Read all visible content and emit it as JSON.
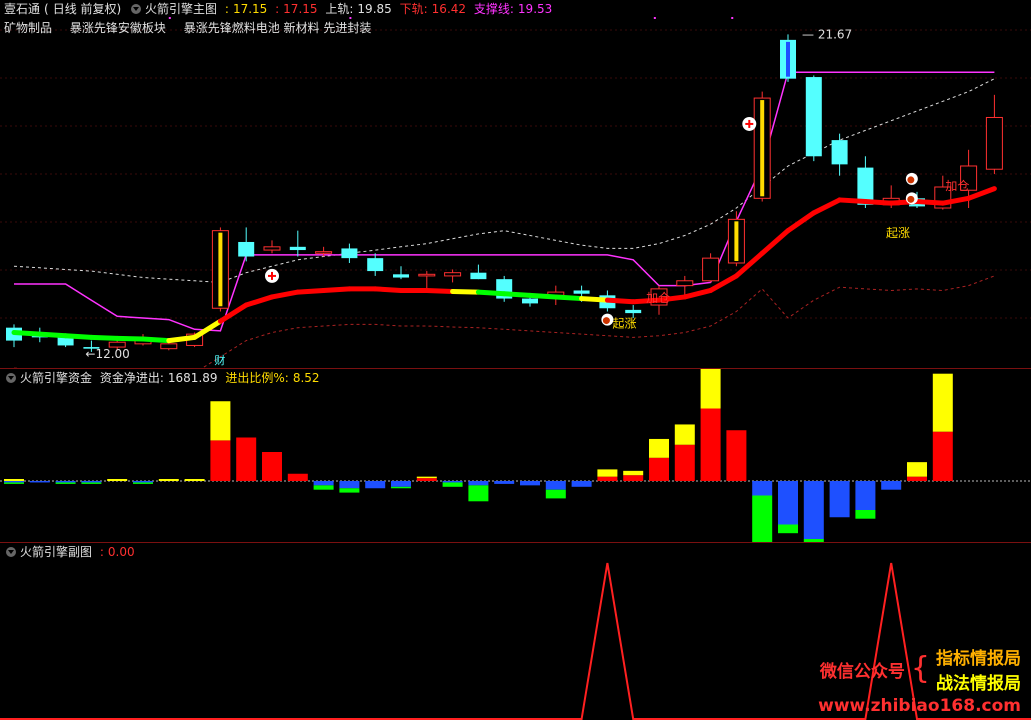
{
  "app": {
    "name": "壹石通",
    "mode": "日线 前复权"
  },
  "main": {
    "indicator_name": "火箭引擎主图",
    "values": [
      {
        "label": "",
        "value": "17.15",
        "color": "#ffdc00"
      },
      {
        "label": "",
        "value": "17.15",
        "color": "#ff3030"
      },
      {
        "label": "上轨",
        "value": "19.85",
        "color": "#e0e0e0"
      },
      {
        "label": "下轨",
        "value": "16.42",
        "color": "#ff3030"
      },
      {
        "label": "支撑线",
        "value": "19.53",
        "color": "#ff33ff"
      }
    ],
    "sectors": [
      "矿物制品",
      "暴涨先锋安徽板块",
      "暴涨先锋燃料电池 新材料 先进封装"
    ],
    "high_label": "21.67",
    "low_label": "12.00",
    "cai_label": "财",
    "signals": [
      {
        "text": "加仓",
        "color": "#ff3030"
      },
      {
        "text": "起涨",
        "color": "#ffdc00"
      },
      {
        "text": "加仓",
        "color": "#ff3030"
      },
      {
        "text": "起涨",
        "color": "#ffdc00"
      }
    ]
  },
  "fund": {
    "indicator_name": "火箭引擎资金",
    "net_label": "资金净进出",
    "net_value": "1681.89",
    "ratio_label": "进出比例%",
    "ratio_value": "8.52"
  },
  "sub": {
    "indicator_name": "火箭引擎副图",
    "value": "0.00"
  },
  "watermark": {
    "wechat": "微信公众号",
    "line1": "指标情报局",
    "line2": "战法情报局",
    "url": "www.zhibiao168.com"
  },
  "colors": {
    "up": "#ff3030",
    "down": "#54ffff",
    "support": "#ff33ff",
    "bull": "#ff0000",
    "bear": "#00ff00",
    "yellow": "#ffff00",
    "fund_out": "#1e50ff"
  },
  "chart_data": {
    "type": "candlestick",
    "candles": [
      {
        "o": 12.6,
        "h": 12.7,
        "l": 12.0,
        "c": 12.2
      },
      {
        "o": 12.4,
        "h": 12.6,
        "l": 12.15,
        "c": 12.3
      },
      {
        "o": 12.3,
        "h": 12.4,
        "l": 12.0,
        "c": 12.05
      },
      {
        "o": 12.0,
        "h": 12.2,
        "l": 11.85,
        "c": 11.95
      },
      {
        "o": 12.0,
        "h": 12.3,
        "l": 11.9,
        "c": 12.15
      },
      {
        "o": 12.1,
        "h": 12.4,
        "l": 12.05,
        "c": 12.2
      },
      {
        "o": 11.95,
        "h": 12.2,
        "l": 11.9,
        "c": 12.1
      },
      {
        "o": 12.05,
        "h": 12.45,
        "l": 12.0,
        "c": 12.4
      },
      {
        "o": 13.2,
        "h": 15.7,
        "l": 13.1,
        "c": 15.6
      },
      {
        "o": 15.25,
        "h": 15.7,
        "l": 14.65,
        "c": 14.8
      },
      {
        "o": 15.0,
        "h": 15.3,
        "l": 14.9,
        "c": 15.1
      },
      {
        "o": 15.1,
        "h": 15.6,
        "l": 14.8,
        "c": 15.0
      },
      {
        "o": 14.9,
        "h": 15.1,
        "l": 14.8,
        "c": 14.95
      },
      {
        "o": 15.05,
        "h": 15.2,
        "l": 14.6,
        "c": 14.75
      },
      {
        "o": 14.75,
        "h": 14.9,
        "l": 14.2,
        "c": 14.35
      },
      {
        "o": 14.25,
        "h": 14.5,
        "l": 14.1,
        "c": 14.15
      },
      {
        "o": 14.2,
        "h": 14.35,
        "l": 13.8,
        "c": 14.25
      },
      {
        "o": 14.2,
        "h": 14.4,
        "l": 14.0,
        "c": 14.3
      },
      {
        "o": 14.3,
        "h": 14.55,
        "l": 14.1,
        "c": 14.1
      },
      {
        "o": 14.1,
        "h": 14.2,
        "l": 13.4,
        "c": 13.5
      },
      {
        "o": 13.5,
        "h": 13.6,
        "l": 13.25,
        "c": 13.35
      },
      {
        "o": 13.6,
        "h": 13.9,
        "l": 13.3,
        "c": 13.7
      },
      {
        "o": 13.75,
        "h": 13.9,
        "l": 13.4,
        "c": 13.65
      },
      {
        "o": 13.6,
        "h": 13.75,
        "l": 13.1,
        "c": 13.2
      },
      {
        "o": 13.15,
        "h": 13.3,
        "l": 12.9,
        "c": 13.05
      },
      {
        "o": 13.3,
        "h": 13.9,
        "l": 13.0,
        "c": 13.8
      },
      {
        "o": 13.9,
        "h": 14.2,
        "l": 13.6,
        "c": 14.05
      },
      {
        "o": 14.05,
        "h": 14.9,
        "l": 14.0,
        "c": 14.75
      },
      {
        "o": 14.6,
        "h": 16.2,
        "l": 14.5,
        "c": 15.95
      },
      {
        "o": 16.6,
        "h": 19.9,
        "l": 16.5,
        "c": 19.7
      },
      {
        "o": 21.5,
        "h": 21.67,
        "l": 20.2,
        "c": 20.3
      },
      {
        "o": 20.35,
        "h": 20.4,
        "l": 17.75,
        "c": 17.9
      },
      {
        "o": 18.4,
        "h": 18.6,
        "l": 17.3,
        "c": 17.65
      },
      {
        "o": 17.55,
        "h": 17.9,
        "l": 16.3,
        "c": 16.4
      },
      {
        "o": 16.4,
        "h": 17.0,
        "l": 16.3,
        "c": 16.6
      },
      {
        "o": 16.6,
        "h": 16.8,
        "l": 16.3,
        "c": 16.35
      },
      {
        "o": 16.3,
        "h": 17.3,
        "l": 16.25,
        "c": 16.95
      },
      {
        "o": 16.85,
        "h": 18.1,
        "l": 16.3,
        "c": 17.6
      },
      {
        "o": 17.5,
        "h": 19.8,
        "l": 17.35,
        "c": 19.1
      }
    ],
    "ma_line": [
      12.45,
      12.4,
      12.35,
      12.3,
      12.27,
      12.25,
      12.2,
      12.3,
      12.8,
      13.3,
      13.55,
      13.7,
      13.75,
      13.8,
      13.8,
      13.75,
      13.75,
      13.72,
      13.7,
      13.65,
      13.6,
      13.55,
      13.5,
      13.45,
      13.4,
      13.45,
      13.55,
      13.75,
      14.2,
      14.9,
      15.6,
      16.15,
      16.55,
      16.5,
      16.45,
      16.5,
      16.45,
      16.6,
      16.9
    ],
    "upper_band": [
      14.5,
      14.45,
      14.4,
      14.35,
      14.25,
      14.15,
      14.1,
      14.05,
      14.0,
      14.3,
      14.5,
      14.7,
      14.8,
      14.9,
      15.0,
      15.1,
      15.2,
      15.35,
      15.5,
      15.6,
      15.45,
      15.3,
      15.15,
      15.05,
      15.05,
      15.2,
      15.45,
      15.8,
      16.3,
      16.95,
      17.6,
      18.0,
      18.4,
      18.7,
      19.0,
      19.3,
      19.6,
      19.9,
      20.3
    ],
    "support_line": [
      13.95,
      13.95,
      13.95,
      13.45,
      12.95,
      12.9,
      12.85,
      12.55,
      12.5,
      14.85,
      14.85,
      14.85,
      14.85,
      14.85,
      14.85,
      14.85,
      14.85,
      14.85,
      14.85,
      14.85,
      14.85,
      14.85,
      14.85,
      14.85,
      14.7,
      13.9,
      13.9,
      14.0,
      15.9,
      17.6,
      20.5,
      20.5,
      20.5,
      20.5,
      20.5,
      20.5,
      20.5,
      20.5,
      20.5
    ],
    "fund_flow": [
      {
        "b": -1,
        "y": -1,
        "g": -1
      },
      {
        "b": -1,
        "y": 0,
        "g": 0
      },
      {
        "b": -1,
        "y": 0,
        "g": -1
      },
      {
        "b": -1,
        "y": 0,
        "g": -1
      },
      {
        "b": 0,
        "y": 1,
        "g": 0
      },
      {
        "b": -1,
        "y": 0,
        "g": -1
      },
      {
        "b": 0,
        "y": 1,
        "g": 0
      },
      {
        "b": 0,
        "y": 1,
        "g": 0
      },
      {
        "r": 28,
        "y": 27
      },
      {
        "r": 30,
        "y": 0
      },
      {
        "r": 20,
        "y": 0
      },
      {
        "r": 5,
        "y": 0
      },
      {
        "b": -3,
        "g": -3
      },
      {
        "b": -5,
        "g": -3
      },
      {
        "b": -5,
        "g": 0
      },
      {
        "b": -4,
        "g": -1
      },
      {
        "r": 2,
        "y": 1
      },
      {
        "b": -1,
        "g": -3
      },
      {
        "b": -3,
        "g": -11
      },
      {
        "b": -2,
        "g": 0
      },
      {
        "b": -3,
        "g": 0
      },
      {
        "b": -6,
        "g": -6
      },
      {
        "b": -4,
        "g": 0
      },
      {
        "r": 3,
        "y": 5
      },
      {
        "r": 4,
        "y": 3
      },
      {
        "r": 16,
        "y": 13
      },
      {
        "r": 25,
        "y": 14
      },
      {
        "r": 50,
        "y": 40
      },
      {
        "r": 35,
        "y": 0
      },
      {
        "b": -10,
        "g": -50
      },
      {
        "b": -30,
        "g": -6
      },
      {
        "b": -40,
        "g": -14
      },
      {
        "b": -25,
        "g": 0
      },
      {
        "b": -20,
        "g": -6
      },
      {
        "b": -6,
        "g": 0
      },
      {
        "r": 3,
        "y": 10
      },
      {
        "r": 34,
        "y": 40
      }
    ],
    "sub_signal": [
      0,
      0,
      0,
      0,
      0,
      0,
      0,
      0,
      0,
      0,
      0,
      0,
      0,
      0,
      0,
      0,
      0,
      0,
      0,
      0,
      0,
      0,
      0,
      1,
      0,
      0,
      0,
      0,
      0,
      0,
      0,
      0,
      0,
      0,
      1,
      0,
      0,
      0,
      0
    ]
  }
}
